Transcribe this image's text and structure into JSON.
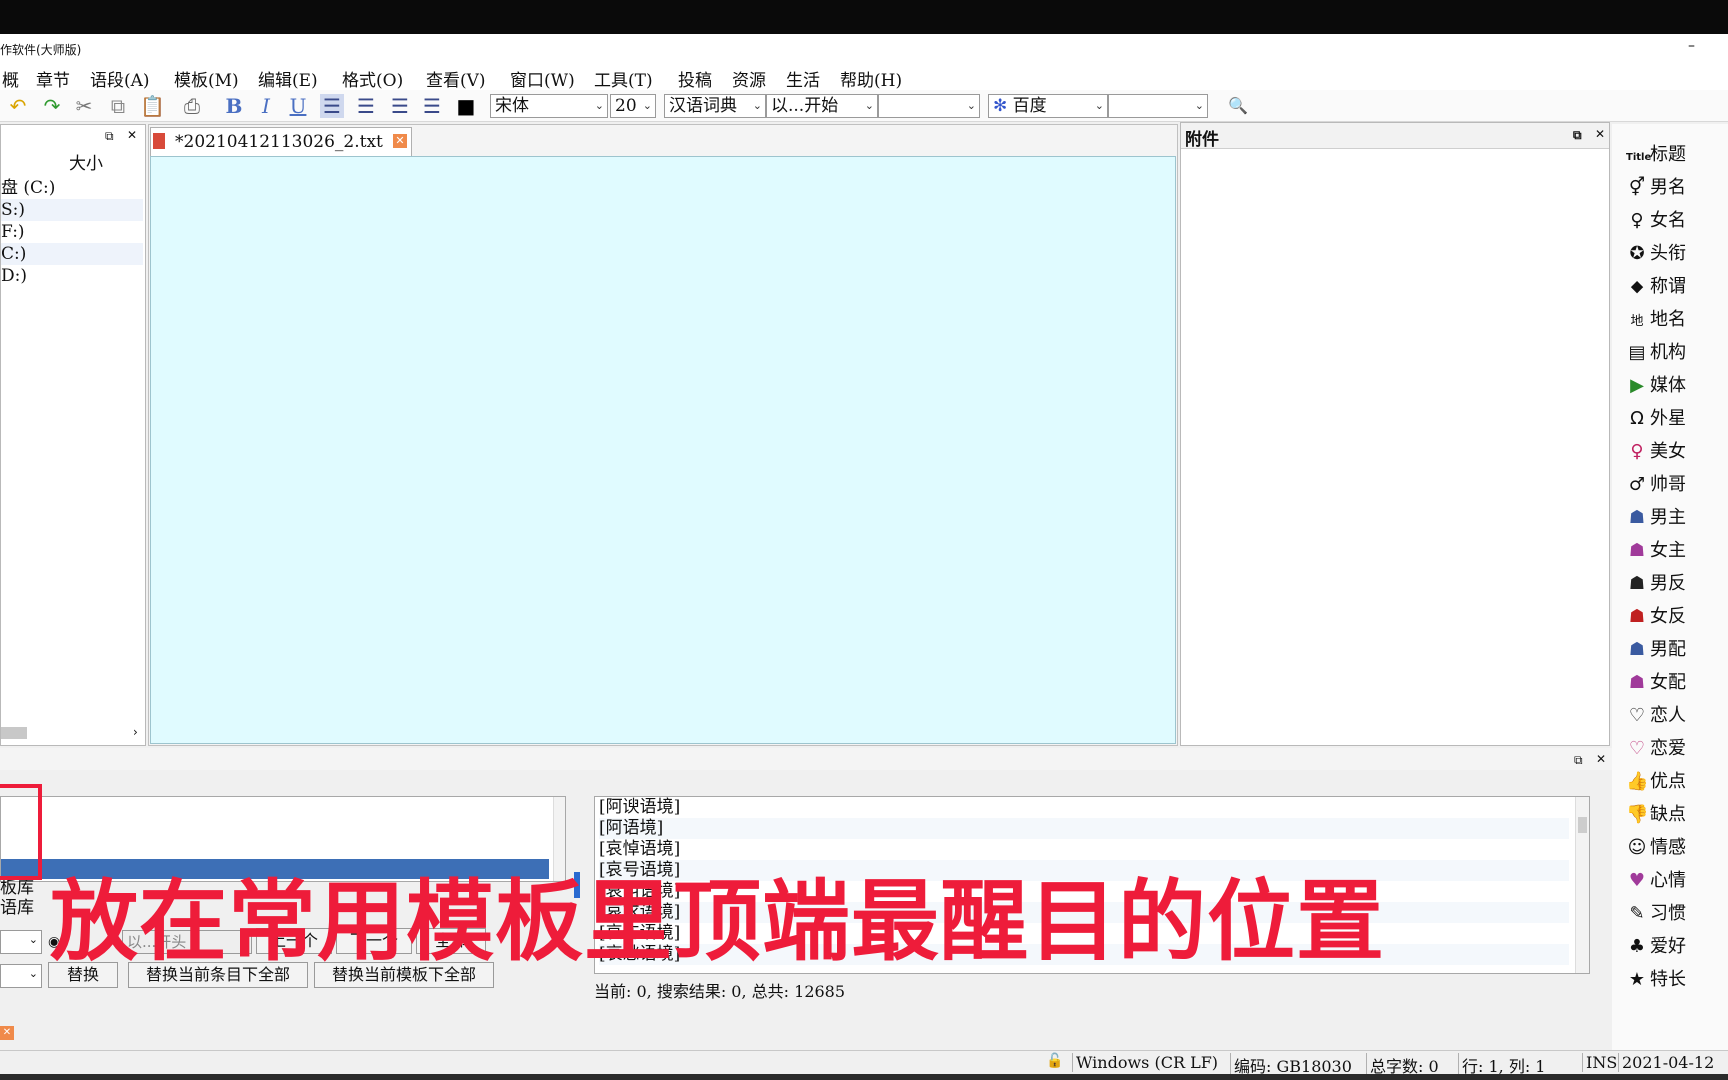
{
  "window": {
    "title": "作软件(大师版)",
    "minimize": "–"
  },
  "menu": [
    "概",
    "章节",
    "语段(A)",
    "模板(M)",
    "编辑(E)",
    "格式(O)",
    "查看(V)",
    "窗口(W)",
    "工具(T)",
    "投稿",
    "资源",
    "生活",
    "帮助(H)"
  ],
  "toolbar": {
    "font_name": "宋体",
    "font_size": "20",
    "dict": "汉语词典",
    "match_mode": "以...开始",
    "search_engine": "百度",
    "bold": "B",
    "italic": "I",
    "underline": "U"
  },
  "left_panel": {
    "column_size": "大小",
    "drives": [
      "盘 (C:)",
      "S:)",
      "F:)",
      "C:)",
      "D:)"
    ]
  },
  "editor": {
    "tab_label": "*20210412113026_2.txt"
  },
  "attach": {
    "title": "附件"
  },
  "right_bar": {
    "items": [
      {
        "icon": "Title",
        "label": "标题"
      },
      {
        "icon": "⚥",
        "label": "男名"
      },
      {
        "icon": "♀",
        "label": "女名"
      },
      {
        "icon": "✪",
        "label": "头衔"
      },
      {
        "icon": "⬥",
        "label": "称谓"
      },
      {
        "icon": "地",
        "label": "地名"
      },
      {
        "icon": "▤",
        "label": "机构"
      },
      {
        "icon": "▶",
        "label": "媒体"
      },
      {
        "icon": "Ω",
        "label": "外星"
      },
      {
        "icon": "♀",
        "label": "美女"
      },
      {
        "icon": "♂",
        "label": "帅哥"
      },
      {
        "icon": "☗",
        "label": "男主"
      },
      {
        "icon": "☗",
        "label": "女主"
      },
      {
        "icon": "☗",
        "label": "男反"
      },
      {
        "icon": "☗",
        "label": "女反"
      },
      {
        "icon": "☗",
        "label": "男配"
      },
      {
        "icon": "☗",
        "label": "女配"
      },
      {
        "icon": "♡",
        "label": "恋人"
      },
      {
        "icon": "♡",
        "label": "恋爱"
      },
      {
        "icon": "👍",
        "label": "优点"
      },
      {
        "icon": "👎",
        "label": "缺点"
      },
      {
        "icon": "☺",
        "label": "情感"
      },
      {
        "icon": "♥",
        "label": "心情"
      },
      {
        "icon": "✎",
        "label": "习惯"
      },
      {
        "icon": "♣",
        "label": "爱好"
      },
      {
        "icon": "★",
        "label": "特长"
      }
    ]
  },
  "bottom": {
    "left_lines": [
      "板库",
      "语库"
    ],
    "context_list": [
      "[阿谀语境]",
      "[阿语境]",
      "[哀悼语境]",
      "[哀号语境]",
      "[哀叫语境]",
      "[哀求语境]",
      "[哀伤语境]",
      "[哀愁语境]"
    ],
    "match_mode": "以...开头",
    "buttons": {
      "up": "上一个",
      "next": "下一个",
      "all": "全部",
      "replace": "替换",
      "replace_all_current": "替换当前条目下全部",
      "replace_all_template": "替换当前模板下全部"
    },
    "search_status": "当前: 0, 搜索结果: 0, 总共: 12685"
  },
  "caption": "放在常用模板里顶端最醒目的位置",
  "status_bar": {
    "line_ending": "Windows (CR LF)",
    "encoding": "编码: GB18030",
    "char_count": "总字数: 0",
    "position": "行: 1, 列: 1",
    "mode": "INS",
    "date": "2021-04-12"
  }
}
